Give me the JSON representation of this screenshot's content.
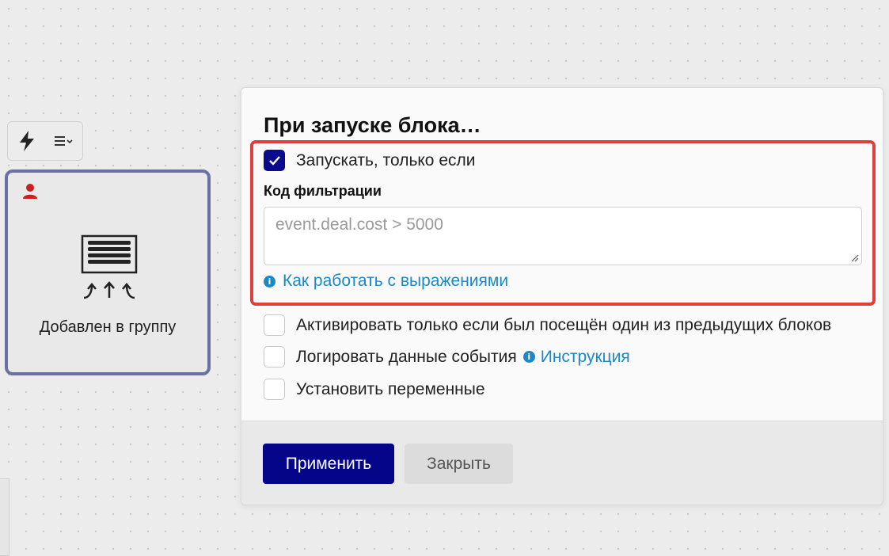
{
  "canvas": {
    "toolbar": {
      "trigger_icon": "lightning-icon",
      "menu_icon": "list-dropdown-icon"
    },
    "block": {
      "label": "Добавлен в группу",
      "icon": "group-stack-icon",
      "badge_icon": "user-icon",
      "badge_color": "#cc1f1f",
      "border_color": "#6a6fa6"
    }
  },
  "modal": {
    "title": "При запуске блока…",
    "options": {
      "run_only_if": {
        "label": "Запускать, только если",
        "checked": true
      },
      "filter": {
        "label": "Код фильтрации",
        "value": "",
        "placeholder": "event.deal.cost > 5000"
      },
      "help_link": "Как работать с выражениями",
      "activate_if_visited": {
        "label": "Активировать только если был посещён один из предыдущих блоков",
        "checked": false
      },
      "log_event": {
        "label": "Логировать данные события",
        "link": "Инструкция",
        "checked": false
      },
      "set_variables": {
        "label": "Установить переменные",
        "checked": false
      }
    },
    "highlight_color": "#e0403a",
    "footer": {
      "apply_label": "Применить",
      "close_label": "Закрыть"
    }
  },
  "colors": {
    "accent": "#05058a",
    "link": "#1a88c9"
  }
}
